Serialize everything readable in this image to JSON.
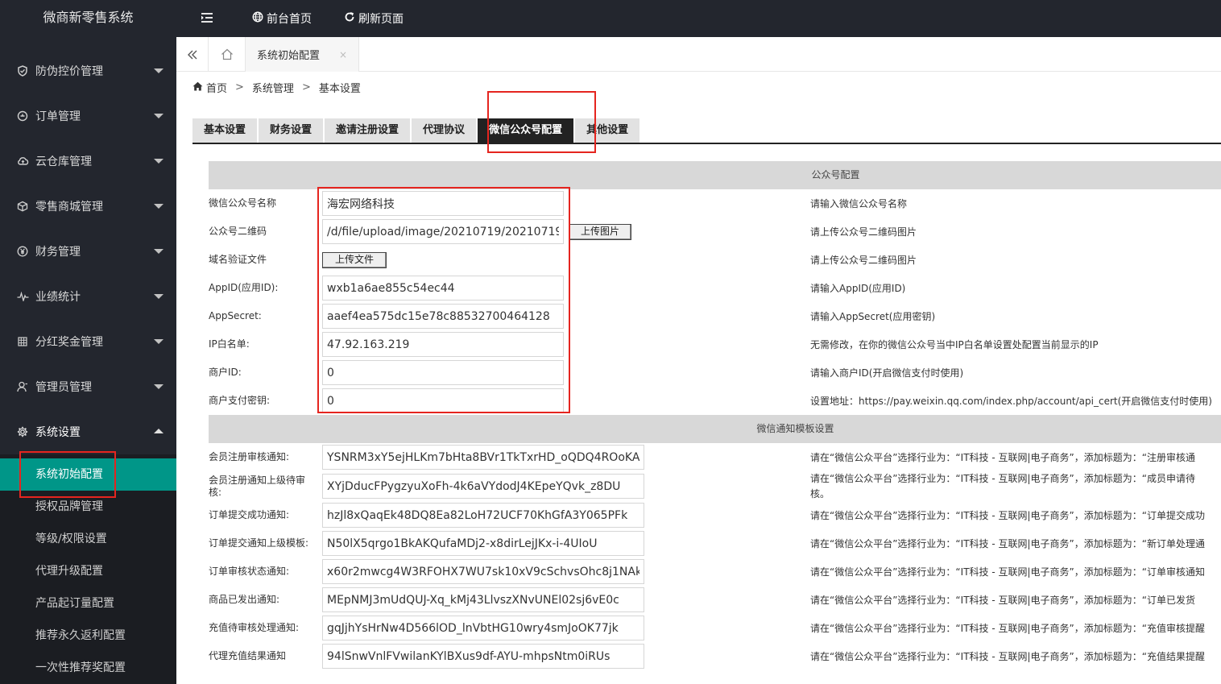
{
  "app": {
    "title": "微商新零售系统"
  },
  "topbar": {
    "home_label": "前台首页",
    "refresh_label": "刷新页面"
  },
  "tabstrip": {
    "active_tab": "系统初始配置",
    "close_glyph": "×"
  },
  "breadcrumb": {
    "items": [
      "首页",
      "系统管理",
      "基本设置"
    ],
    "separator": ">"
  },
  "sidebar": {
    "items": [
      {
        "label": "防伪控价管理",
        "icon": "shield-icon"
      },
      {
        "label": "订单管理",
        "icon": "order-icon"
      },
      {
        "label": "云仓库管理",
        "icon": "cloud-icon"
      },
      {
        "label": "零售商城管理",
        "icon": "box-icon"
      },
      {
        "label": "财务管理",
        "icon": "yen-icon"
      },
      {
        "label": "业绩统计",
        "icon": "pulse-icon"
      },
      {
        "label": "分红奖金管理",
        "icon": "grid-icon"
      },
      {
        "label": "管理员管理",
        "icon": "user-icon"
      },
      {
        "label": "系统设置",
        "icon": "gear-icon"
      }
    ],
    "subitems": [
      "系统初始配置",
      "授权品牌管理",
      "等级/权限设置",
      "代理升级配置",
      "产品起订量配置",
      "推荐永久返利配置",
      "一次性推荐奖配置"
    ]
  },
  "settings_tabs": [
    "基本设置",
    "财务设置",
    "邀请注册设置",
    "代理协议",
    "微信公众号配置",
    "其他设置"
  ],
  "active_settings_tab": "微信公众号配置",
  "mp_config": {
    "section_title": "公众号配置",
    "upload_image_label": "上传图片",
    "upload_file_label": "上传文件",
    "rows": [
      {
        "label": "微信公众号名称",
        "value": "海宏网络科技",
        "hint": "请输入微信公众号名称"
      },
      {
        "label": "公众号二维码",
        "value": "/d/file/upload/image/20210719/202107191",
        "hint": "请上传公众号二维码图片"
      },
      {
        "label": "域名验证文件",
        "value": "",
        "hint": "请上传公众号二维码图片"
      },
      {
        "label": "AppID(应用ID):",
        "value": "wxb1a6ae855c54ec44",
        "hint": "请输入AppID(应用ID)"
      },
      {
        "label": "AppSecret:",
        "value": "aaef4ea575dc15e78c88532700464128",
        "hint": "请输入AppSecret(应用密钥)"
      },
      {
        "label": "IP白名单:",
        "value": "47.92.163.219",
        "hint": "无需修改，在你的微信公众号当中IP白名单设置处配置当前显示的IP"
      },
      {
        "label": "商户ID:",
        "value": "0",
        "hint": "请输入商户ID(开启微信支付时使用)"
      },
      {
        "label": "商户支付密钥:",
        "value": "0",
        "hint": "设置地址：https://pay.weixin.qq.com/index.php/account/api_cert(开启微信支付时使用)"
      }
    ]
  },
  "template_config": {
    "section_title": "微信通知模板设置",
    "rows": [
      {
        "label": "会员注册审核通知:",
        "value": "YSNRM3xY5ejHLKm7bHta8BVr1TkTxrHD_oQDQ4ROoKA",
        "hint": "请在“微信公众平台”选择行业为：“IT科技 - 互联网|电子商务”，添加标题为：“注册审核通"
      },
      {
        "label": "会员注册通知上级待审核:",
        "value": "XYjDducFPygzyuXoFh-4k6aVYdodJ4KEpeYQvk_z8DU",
        "hint": "请在“微信公众平台”选择行业为：“IT科技 - 互联网|电子商务”，添加标题为：“成员申请待",
        "hint2": "核。"
      },
      {
        "label": "订单提交成功通知:",
        "value": "hzJl8xQaqEk48DQ8Ea82LoH72UCF70KhGfA3Y065PFk",
        "hint": "请在“微信公众平台”选择行业为：“IT科技 - 互联网|电子商务”，添加标题为：“订单提交成功"
      },
      {
        "label": "订单提交通知上级模板:",
        "value": "N50lX5qrgo1BkAKQufaMDj2-x8dirLejJKx-i-4UIoU",
        "hint": "请在“微信公众平台”选择行业为：“IT科技 - 互联网|电子商务”，添加标题为：“新订单处理通"
      },
      {
        "label": "订单审核状态通知:",
        "value": "x60r2mwcg4W3RFOHX7WU7sk10xV9cSchvsOhc8j1NAk",
        "hint": "请在“微信公众平台”选择行业为：“IT科技 - 互联网|电子商务”，添加标题为：“订单审核通知"
      },
      {
        "label": "商品已发出通知:",
        "value": "MEpNMJ3mUdQUJ-Xq_kMj43LlvszXNvUNEl02sj6vE0c",
        "hint": "请在“微信公众平台”选择行业为：“IT科技 - 互联网|电子商务”，添加标题为：“订单已发货"
      },
      {
        "label": "充值待审核处理通知:",
        "value": "gqJjhYsHrNw4D566lOD_lnVbtHG10wry4smJoOK77jk",
        "hint": "请在“微信公众平台”选择行业为：“IT科技 - 互联网|电子商务”，添加标题为：“充值审核提醒"
      },
      {
        "label": "代理充值结果通知",
        "value": "94lSnwVnlFVwilanKYlBXus9df-AYU-mhpsNtm0iRUs",
        "hint": "请在“微信公众平台”选择行业为：“IT科技 - 互联网|电子商务”，添加标题为：“充值结果提醒"
      }
    ]
  },
  "colors": {
    "sidebar_bg": "#23262e",
    "active_teal": "#009688",
    "highlight_red": "#e5251f"
  }
}
